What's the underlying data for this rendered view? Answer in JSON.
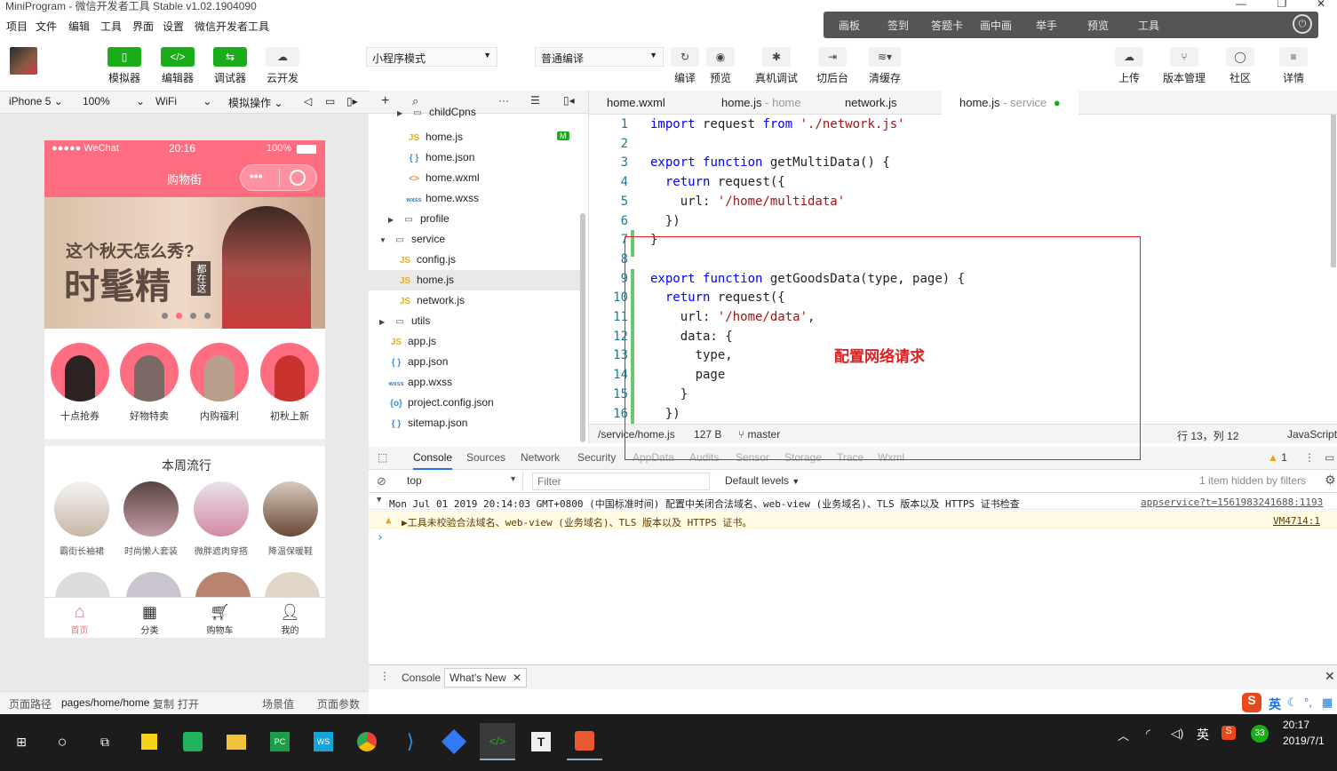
{
  "window": {
    "title": "MiniProgram - 微信开发者工具 Stable v1.02.1904090"
  },
  "menu": [
    "项目",
    "文件",
    "编辑",
    "工具",
    "界面",
    "设置",
    "微信开发者工具"
  ],
  "float_toolbar": [
    "画板",
    "签到",
    "答题卡",
    "画中画",
    "举手",
    "预览",
    "工具"
  ],
  "toolbar": {
    "left": [
      {
        "label": "模拟器",
        "icon": "phone-icon"
      },
      {
        "label": "编辑器",
        "icon": "code-icon"
      },
      {
        "label": "调试器",
        "icon": "debug-icon"
      },
      {
        "label": "云开发",
        "icon": "cloud-dev-icon"
      }
    ],
    "mode_select": "小程序模式",
    "compile_select": "普通编译",
    "mid": [
      {
        "label": "编译",
        "icon": "refresh-icon"
      },
      {
        "label": "预览",
        "icon": "eye-icon"
      },
      {
        "label": "真机调试",
        "icon": "bug-icon"
      },
      {
        "label": "切后台",
        "icon": "switch-icon"
      },
      {
        "label": "清缓存",
        "icon": "layers-icon"
      }
    ],
    "right": [
      {
        "label": "上传",
        "icon": "upload-icon"
      },
      {
        "label": "版本管理",
        "icon": "branch-icon"
      },
      {
        "label": "社区",
        "icon": "chat-icon"
      },
      {
        "label": "详情",
        "icon": "menu-icon"
      }
    ]
  },
  "simulator": {
    "device": "iPhone 5",
    "zoom": "100%",
    "network": "WiFi",
    "ops": "模拟操作",
    "status_left": "●●●●● WeChat",
    "status_time": "20:16",
    "status_battery": "100%",
    "nav_title": "购物街",
    "banner_line1": "这个秋天怎么秀?",
    "banner_line2": "时髦精",
    "banner_side": "都在这",
    "categories": [
      "十点抢券",
      "好物特卖",
      "内购福利",
      "初秋上新"
    ],
    "weekly_title": "本周流行",
    "popular": [
      "霸街长袖裙",
      "时尚懒人套装",
      "微胖遮肉穿搭",
      "降温保暖鞋"
    ],
    "tabs": [
      "首页",
      "分类",
      "购物车",
      "我的"
    ],
    "accent": "#ff6d80"
  },
  "filetree": {
    "items": [
      {
        "label": "childCpns",
        "type": "folder",
        "indent": 3,
        "open": false
      },
      {
        "label": "home.js",
        "type": "js",
        "indent": 4,
        "badge": "M"
      },
      {
        "label": "home.json",
        "type": "json",
        "indent": 4
      },
      {
        "label": "home.wxml",
        "type": "wxml",
        "indent": 4
      },
      {
        "label": "home.wxss",
        "type": "wxss",
        "indent": 4
      },
      {
        "label": "profile",
        "type": "folder",
        "indent": 2,
        "open": false
      },
      {
        "label": "service",
        "type": "folder",
        "indent": 1,
        "open": true
      },
      {
        "label": "config.js",
        "type": "js",
        "indent": 3
      },
      {
        "label": "home.js",
        "type": "js",
        "indent": 3,
        "selected": true
      },
      {
        "label": "network.js",
        "type": "js",
        "indent": 3
      },
      {
        "label": "utils",
        "type": "folder",
        "indent": 1,
        "open": false
      },
      {
        "label": "app.js",
        "type": "js",
        "indent": 2
      },
      {
        "label": "app.json",
        "type": "json",
        "indent": 2
      },
      {
        "label": "app.wxss",
        "type": "wxss",
        "indent": 2
      },
      {
        "label": "project.config.json",
        "type": "config",
        "indent": 2
      },
      {
        "label": "sitemap.json",
        "type": "json",
        "indent": 2
      }
    ]
  },
  "editor_tabs": [
    {
      "label": "home.wxml",
      "sub": ""
    },
    {
      "label": "home.js",
      "sub": "- home"
    },
    {
      "label": "network.js",
      "sub": ""
    },
    {
      "label": "home.js",
      "sub": "- service",
      "active": true
    }
  ],
  "code": [
    "import request from './network.js'",
    "",
    "export function getMultiData() {",
    "  return request({",
    "    url: '/home/multidata'",
    "  })",
    "}",
    "",
    "export function getGoodsData(type, page) {",
    "  return request({",
    "    url: '/home/data',",
    "    data: {",
    "      type,",
    "      page",
    "    }",
    "  })"
  ],
  "annotation": "配置网络请求",
  "statusbar": {
    "path": "/service/home.js",
    "size": "127 B",
    "branch": "master",
    "position": "行 13，列 12",
    "lang": "JavaScript"
  },
  "devtools": {
    "tabs": [
      "Console",
      "Sources",
      "Network",
      "Security",
      "AppData",
      "Audits",
      "Sensor",
      "Storage",
      "Trace",
      "Wxml"
    ],
    "warn_count": "1",
    "context": "top",
    "filter_placeholder": "Filter",
    "levels": "Default levels",
    "hidden": "1 item hidden by filters",
    "log1": "Mon Jul 01 2019 20:14:03 GMT+0800 (中国标准时间) 配置中关闭合法域名、web-view (业务域名)、TLS 版本以及 HTTPS 证书检查",
    "log1_src": "appservice?t=1561983241688:1193",
    "log2": "▶工具未校验合法域名、web-view (业务域名)、TLS 版本以及 HTTPS 证书。",
    "log2_src": "VM4714:1",
    "drawer_tabs": [
      "Console",
      "What's New"
    ]
  },
  "pathbar": {
    "label": "页面路径",
    "path": "pages/home/home",
    "copy": "复制",
    "open": "打开",
    "scene": "场景值",
    "params": "页面参数"
  },
  "taskbar": {
    "time": "20:17",
    "date": "2019/7/1",
    "lang": "英",
    "badge": "33"
  }
}
